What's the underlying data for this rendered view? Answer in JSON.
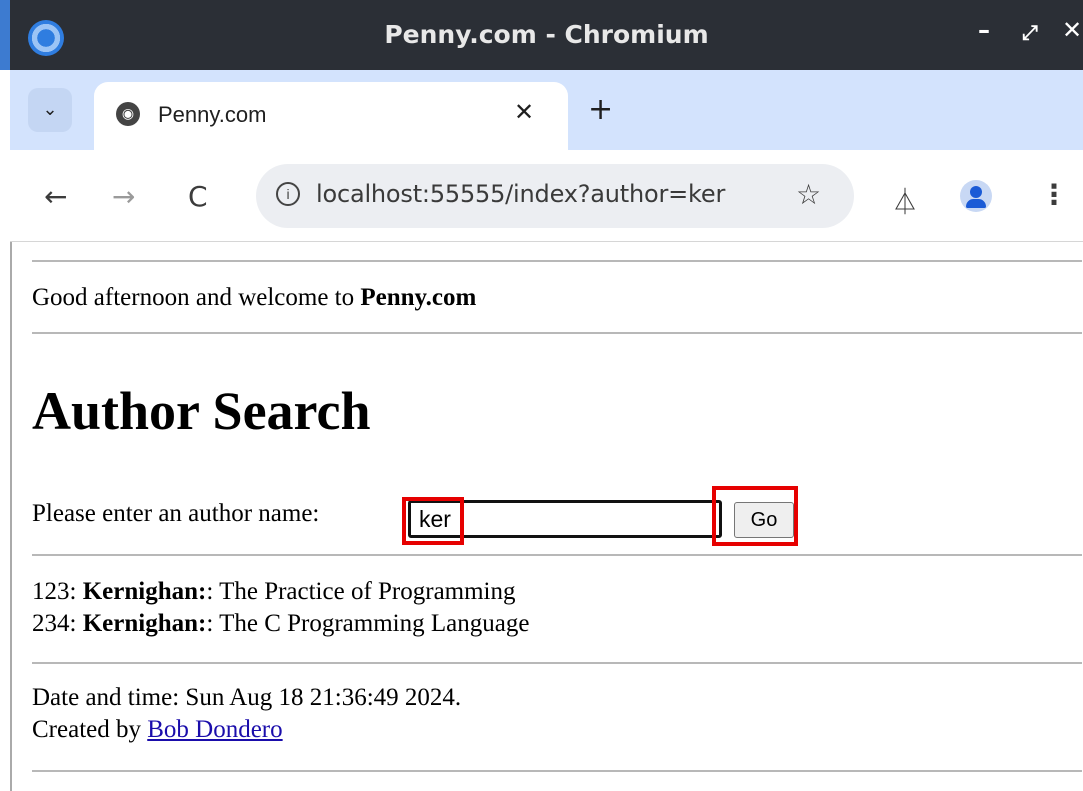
{
  "window": {
    "title": "Penny.com - Chromium",
    "buttons": {
      "minimize": "–",
      "maximize": "⤢",
      "close": "✕"
    }
  },
  "tabs": [
    {
      "title": "Penny.com",
      "active": true,
      "close": "✕"
    }
  ],
  "tab_strip": {
    "new_tab": "+",
    "dropdown": "⌄"
  },
  "toolbar": {
    "back": "←",
    "forward": "→",
    "reload": "C",
    "url": "localhost:55555/index?author=ker",
    "star": "☆",
    "labs": "⏃",
    "menu": "⋮"
  },
  "page": {
    "greeting_prefix": "Good afternoon and welcome to ",
    "greeting_site": "Penny.com",
    "heading": "Author Search",
    "prompt": "Please enter an author name:",
    "author_value": "ker",
    "go_label": "Go",
    "results": [
      {
        "id": "123",
        "author": "Kernighan:",
        "title": ": The Practice of Programming"
      },
      {
        "id": "234",
        "author": "Kernighan:",
        "title": ": The C Programming Language"
      }
    ],
    "footer": {
      "datetime": "Date and time: Sun Aug 18 21:36:49 2024.",
      "created_by": "Created by ",
      "author_link": "Bob Dondero"
    }
  },
  "colors": {
    "highlight": "#e60000",
    "tab_strip": "#d3e3fd",
    "titlebar": "#2b2f36",
    "link": "#1a0dab"
  }
}
